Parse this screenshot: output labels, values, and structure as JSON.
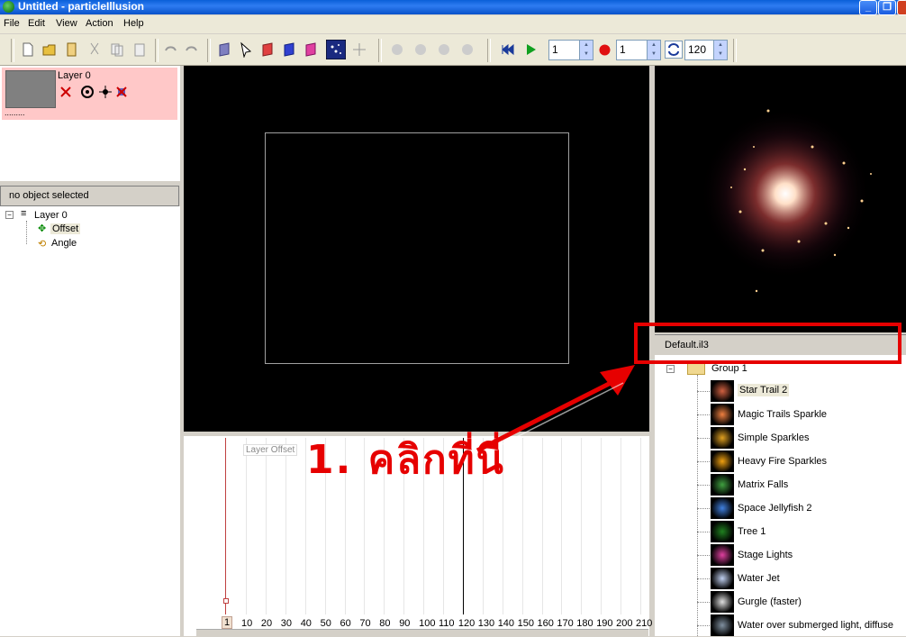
{
  "window": {
    "title": "Untitled - particleIllusion",
    "min": "_",
    "restore": "❐",
    "close": "×"
  },
  "menu": [
    "File",
    "Edit",
    "View",
    "Action",
    "Help"
  ],
  "toolbar": {
    "frame_value": "1",
    "record_value": "1",
    "loop_value": "120"
  },
  "layers": {
    "layer_name": "Layer 0",
    "dots": "........."
  },
  "properties": {
    "header": "no object selected",
    "tree_root": "Layer 0",
    "children": [
      "Offset",
      "Angle"
    ]
  },
  "timeline": {
    "track_label": "Layer Offset",
    "current_frame": "1",
    "ticks": [
      "10",
      "20",
      "30",
      "40",
      "50",
      "60",
      "70",
      "80",
      "90",
      "100",
      "110",
      "120",
      "130",
      "140",
      "150",
      "160",
      "170",
      "180",
      "190",
      "200",
      "210"
    ]
  },
  "library": {
    "file": "Default.il3",
    "group": "Group 1",
    "items": [
      {
        "name": "Star Trail 2",
        "color": "#d06040"
      },
      {
        "name": "Magic Trails Sparkle",
        "color": "#f08040"
      },
      {
        "name": "Simple Sparkles",
        "color": "#e0a020"
      },
      {
        "name": "Heavy Fire Sparkles",
        "color": "#f0a010"
      },
      {
        "name": "Matrix Falls",
        "color": "#40a040"
      },
      {
        "name": "Space Jellyfish 2",
        "color": "#4080e0"
      },
      {
        "name": "Tree 1",
        "color": "#208020"
      },
      {
        "name": "Stage Lights",
        "color": "#e040a0"
      },
      {
        "name": "Water Jet",
        "color": "#c0d0f0"
      },
      {
        "name": "Gurgle (faster)",
        "color": "#e0e0e0"
      },
      {
        "name": "Water over submerged light, diffuse",
        "color": "#8090a0"
      }
    ]
  },
  "annotation": {
    "text": "1. คลิกที่นี่",
    "color": "#e60000"
  },
  "colors": {
    "title_blue": "#0a5fd8",
    "layer_row_pink": "#ffc8c8"
  }
}
